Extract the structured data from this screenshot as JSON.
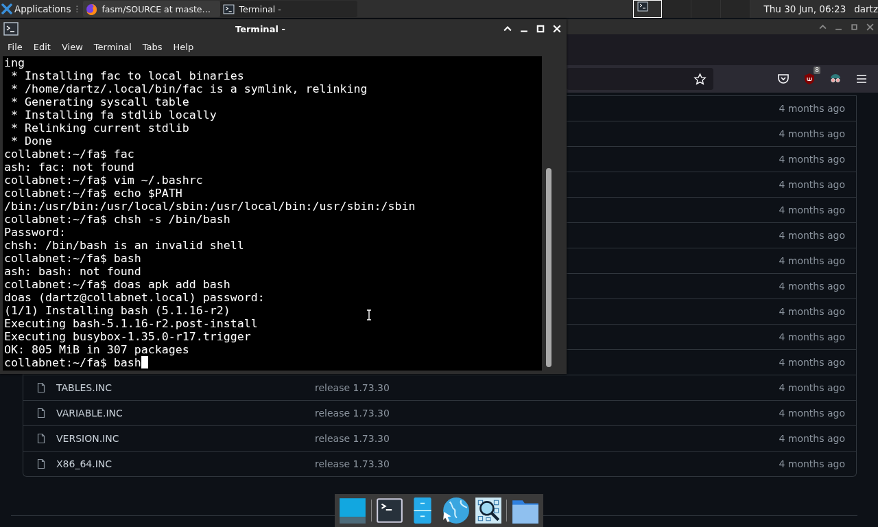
{
  "panel": {
    "apps_label": "Applications",
    "handle": "⋮",
    "tasks": [
      {
        "label": "fasm/SOURCE at maste…",
        "kind": "browser",
        "selected": true
      },
      {
        "label": "Terminal -",
        "kind": "terminal",
        "selected": false
      }
    ],
    "clock": "Thu 30 Jun, 06:23",
    "user": "dartz"
  },
  "browser": {
    "badge": "8",
    "rows": [
      {
        "age": "4 months ago"
      },
      {
        "age": "4 months ago"
      },
      {
        "age": "4 months ago"
      },
      {
        "age": "4 months ago"
      },
      {
        "age": "4 months ago"
      },
      {
        "age": "4 months ago"
      },
      {
        "age": "4 months ago"
      },
      {
        "age": "4 months ago"
      },
      {
        "age": "4 months ago"
      },
      {
        "age": "4 months ago"
      },
      {
        "age": "4 months ago"
      },
      {
        "name": "TABLES.INC",
        "message": "release 1.73.30",
        "age": "4 months ago"
      },
      {
        "name": "VARIABLE.INC",
        "message": "release 1.73.30",
        "age": "4 months ago"
      },
      {
        "name": "VERSION.INC",
        "message": "release 1.73.30",
        "age": "4 months ago"
      },
      {
        "name": "X86_64.INC",
        "message": "release 1.73.30",
        "age": "4 months ago"
      }
    ]
  },
  "terminal": {
    "title": "Terminal -",
    "menu": [
      "File",
      "Edit",
      "View",
      "Terminal",
      "Tabs",
      "Help"
    ],
    "lines": [
      "ing",
      " * Installing fac to local binaries",
      " * /home/dartz/.local/bin/fac is a symlink, relinking",
      " * Generating syscall table",
      " * Installing fa stdlib locally",
      " * Relinking current stdlib",
      " * Done",
      "collabnet:~/fa$ fac",
      "ash: fac: not found",
      "collabnet:~/fa$ vim ~/.bashrc",
      "collabnet:~/fa$ echo $PATH",
      "/bin:/usr/bin:/usr/local/sbin:/usr/local/bin:/usr/sbin:/sbin",
      "collabnet:~/fa$ chsh -s /bin/bash",
      "Password:",
      "chsh: /bin/bash is an invalid shell",
      "collabnet:~/fa$ bash",
      "ash: bash: not found",
      "collabnet:~/fa$ doas apk add bash",
      "doas (dartz@collabnet.local) password:",
      "(1/1) Installing bash (5.1.16-r2)",
      "Executing bash-5.1.16-r2.post-install",
      "Executing busybox-1.35.0-r17.trigger",
      "OK: 805 MiB in 307 packages"
    ],
    "prompt": {
      "text": "collabnet:~/fa$ bash",
      "cursor": true
    }
  },
  "dock": [
    {
      "kind": "desktop"
    },
    {
      "kind": "separator"
    },
    {
      "kind": "terminal"
    },
    {
      "kind": "cabinet"
    },
    {
      "kind": "globe"
    },
    {
      "kind": "search"
    },
    {
      "kind": "separator"
    },
    {
      "kind": "folder"
    }
  ]
}
